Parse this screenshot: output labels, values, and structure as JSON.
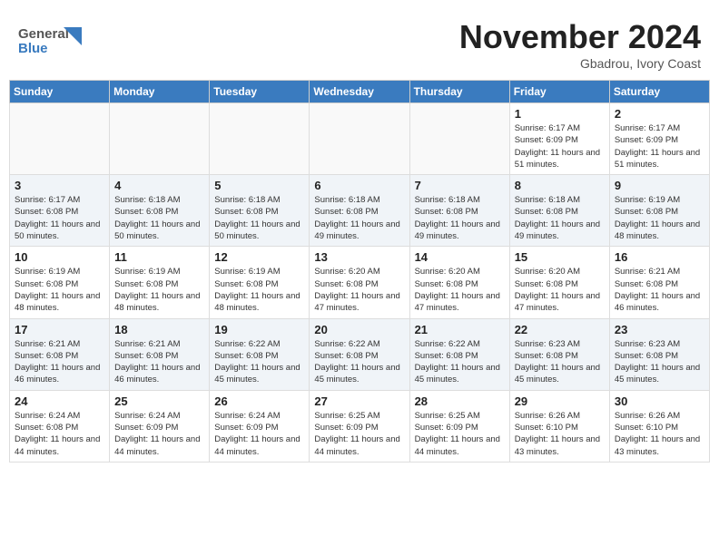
{
  "header": {
    "logo_general": "General",
    "logo_blue": "Blue",
    "month_title": "November 2024",
    "location": "Gbadrou, Ivory Coast"
  },
  "days_of_week": [
    "Sunday",
    "Monday",
    "Tuesday",
    "Wednesday",
    "Thursday",
    "Friday",
    "Saturday"
  ],
  "weeks": [
    [
      {
        "day": "",
        "info": ""
      },
      {
        "day": "",
        "info": ""
      },
      {
        "day": "",
        "info": ""
      },
      {
        "day": "",
        "info": ""
      },
      {
        "day": "",
        "info": ""
      },
      {
        "day": "1",
        "info": "Sunrise: 6:17 AM\nSunset: 6:09 PM\nDaylight: 11 hours and 51 minutes."
      },
      {
        "day": "2",
        "info": "Sunrise: 6:17 AM\nSunset: 6:09 PM\nDaylight: 11 hours and 51 minutes."
      }
    ],
    [
      {
        "day": "3",
        "info": "Sunrise: 6:17 AM\nSunset: 6:08 PM\nDaylight: 11 hours and 50 minutes."
      },
      {
        "day": "4",
        "info": "Sunrise: 6:18 AM\nSunset: 6:08 PM\nDaylight: 11 hours and 50 minutes."
      },
      {
        "day": "5",
        "info": "Sunrise: 6:18 AM\nSunset: 6:08 PM\nDaylight: 11 hours and 50 minutes."
      },
      {
        "day": "6",
        "info": "Sunrise: 6:18 AM\nSunset: 6:08 PM\nDaylight: 11 hours and 49 minutes."
      },
      {
        "day": "7",
        "info": "Sunrise: 6:18 AM\nSunset: 6:08 PM\nDaylight: 11 hours and 49 minutes."
      },
      {
        "day": "8",
        "info": "Sunrise: 6:18 AM\nSunset: 6:08 PM\nDaylight: 11 hours and 49 minutes."
      },
      {
        "day": "9",
        "info": "Sunrise: 6:19 AM\nSunset: 6:08 PM\nDaylight: 11 hours and 48 minutes."
      }
    ],
    [
      {
        "day": "10",
        "info": "Sunrise: 6:19 AM\nSunset: 6:08 PM\nDaylight: 11 hours and 48 minutes."
      },
      {
        "day": "11",
        "info": "Sunrise: 6:19 AM\nSunset: 6:08 PM\nDaylight: 11 hours and 48 minutes."
      },
      {
        "day": "12",
        "info": "Sunrise: 6:19 AM\nSunset: 6:08 PM\nDaylight: 11 hours and 48 minutes."
      },
      {
        "day": "13",
        "info": "Sunrise: 6:20 AM\nSunset: 6:08 PM\nDaylight: 11 hours and 47 minutes."
      },
      {
        "day": "14",
        "info": "Sunrise: 6:20 AM\nSunset: 6:08 PM\nDaylight: 11 hours and 47 minutes."
      },
      {
        "day": "15",
        "info": "Sunrise: 6:20 AM\nSunset: 6:08 PM\nDaylight: 11 hours and 47 minutes."
      },
      {
        "day": "16",
        "info": "Sunrise: 6:21 AM\nSunset: 6:08 PM\nDaylight: 11 hours and 46 minutes."
      }
    ],
    [
      {
        "day": "17",
        "info": "Sunrise: 6:21 AM\nSunset: 6:08 PM\nDaylight: 11 hours and 46 minutes."
      },
      {
        "day": "18",
        "info": "Sunrise: 6:21 AM\nSunset: 6:08 PM\nDaylight: 11 hours and 46 minutes."
      },
      {
        "day": "19",
        "info": "Sunrise: 6:22 AM\nSunset: 6:08 PM\nDaylight: 11 hours and 45 minutes."
      },
      {
        "day": "20",
        "info": "Sunrise: 6:22 AM\nSunset: 6:08 PM\nDaylight: 11 hours and 45 minutes."
      },
      {
        "day": "21",
        "info": "Sunrise: 6:22 AM\nSunset: 6:08 PM\nDaylight: 11 hours and 45 minutes."
      },
      {
        "day": "22",
        "info": "Sunrise: 6:23 AM\nSunset: 6:08 PM\nDaylight: 11 hours and 45 minutes."
      },
      {
        "day": "23",
        "info": "Sunrise: 6:23 AM\nSunset: 6:08 PM\nDaylight: 11 hours and 45 minutes."
      }
    ],
    [
      {
        "day": "24",
        "info": "Sunrise: 6:24 AM\nSunset: 6:08 PM\nDaylight: 11 hours and 44 minutes."
      },
      {
        "day": "25",
        "info": "Sunrise: 6:24 AM\nSunset: 6:09 PM\nDaylight: 11 hours and 44 minutes."
      },
      {
        "day": "26",
        "info": "Sunrise: 6:24 AM\nSunset: 6:09 PM\nDaylight: 11 hours and 44 minutes."
      },
      {
        "day": "27",
        "info": "Sunrise: 6:25 AM\nSunset: 6:09 PM\nDaylight: 11 hours and 44 minutes."
      },
      {
        "day": "28",
        "info": "Sunrise: 6:25 AM\nSunset: 6:09 PM\nDaylight: 11 hours and 44 minutes."
      },
      {
        "day": "29",
        "info": "Sunrise: 6:26 AM\nSunset: 6:10 PM\nDaylight: 11 hours and 43 minutes."
      },
      {
        "day": "30",
        "info": "Sunrise: 6:26 AM\nSunset: 6:10 PM\nDaylight: 11 hours and 43 minutes."
      }
    ]
  ]
}
